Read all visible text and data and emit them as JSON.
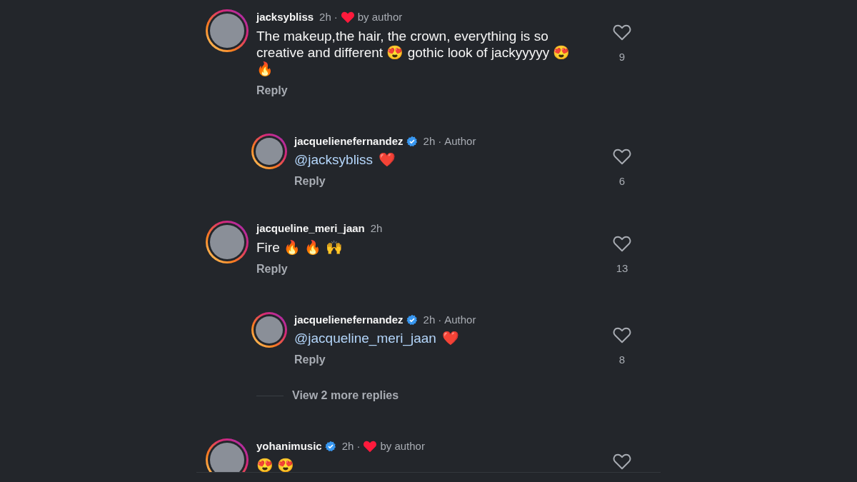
{
  "comments": [
    {
      "user": "jacksybliss",
      "verified": false,
      "time": "2h",
      "separator": "·",
      "liked_by_author": true,
      "liked_label": "by author",
      "text": "The makeup,the hair, the crown, everything is so creative and different 😍 gothic look of jackyyyyy 😍 🔥",
      "reply": "Reply",
      "likes": "9",
      "replies": [
        {
          "user": "jacquelienefernandez",
          "verified": true,
          "time": "2h",
          "separator": "·",
          "author_label": "Author",
          "mention": "@jacksybliss",
          "text": "❤️",
          "reply": "Reply",
          "likes": "6"
        }
      ]
    },
    {
      "user": "jacqueline_meri_jaan",
      "verified": false,
      "time": "2h",
      "liked_by_author": false,
      "text": "Fire 🔥 🔥 🙌",
      "reply": "Reply",
      "likes": "13",
      "replies": [
        {
          "user": "jacquelienefernandez",
          "verified": true,
          "time": "2h",
          "separator": "·",
          "author_label": "Author",
          "mention": "@jacqueline_meri_jaan",
          "text": "❤️",
          "reply": "Reply",
          "likes": "8"
        }
      ],
      "more_replies": "View 2 more replies"
    },
    {
      "user": "yohanimusic",
      "verified": true,
      "time": "2h",
      "separator": "·",
      "liked_by_author": true,
      "liked_label": "by author",
      "text": "😍 😍"
    }
  ]
}
